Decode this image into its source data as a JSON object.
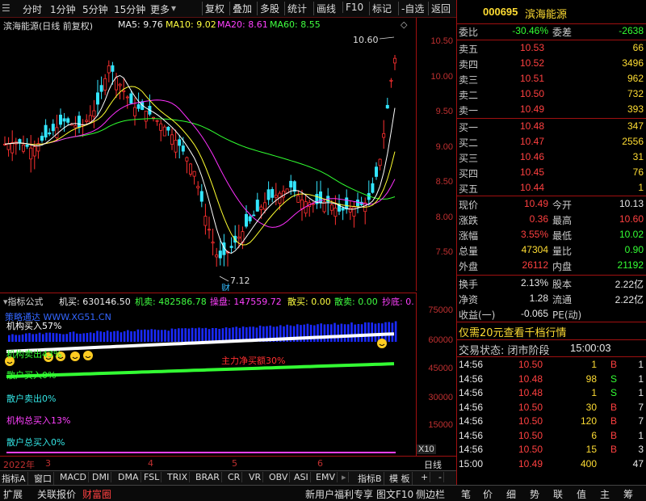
{
  "toolbar": {
    "periods": [
      "分时",
      "1分钟",
      "5分钟",
      "15分钟",
      "更多"
    ],
    "buttons": [
      "复权",
      "叠加",
      "多股",
      "统计",
      "画线",
      "F10",
      "标记",
      "-自选",
      "返回"
    ]
  },
  "chart_header": {
    "name": "滨海能源(日线 前复权)",
    "ma5": "MA5: 9.76",
    "ma10": "MA10: 9.02",
    "ma20": "MA20: 8.61",
    "ma60": "MA60: 8.55",
    "high_mark": "10.60",
    "low_mark": "7.12",
    "cai_mark": "财"
  },
  "colors": {
    "up": "#ff3030",
    "down": "#33e6ff",
    "ma5": "#ffffff",
    "ma10": "#ffff30",
    "ma20": "#ff30ff",
    "ma60": "#30ff30",
    "border": "#a01010"
  },
  "price_axis": [
    "10.50",
    "10.00",
    "9.50",
    "9.00",
    "8.50",
    "8.00",
    "7.50"
  ],
  "indicator": {
    "title": "指标公式",
    "jimai": "机买: 630146.50",
    "jimai2": "机卖: 482586.78",
    "caopan": "操盘: 147559.72",
    "sanmai": "散买: 0.00",
    "sanmai2": "散卖: 0.00",
    "chaodi": "抄底: 0.",
    "watermark": "策略通达 WWW.XG51.CN",
    "labels": {
      "jigou_buy": "机构买入57%",
      "jigou_sell": "机构卖出43%",
      "sanhu_buy": "散户买入0%",
      "zhuli": "主力净买额30%",
      "sanhu_sell": "散户卖出0%",
      "jigou_total": "机构总买入13%",
      "sanhu_total": "散户总买入0%"
    },
    "axis": [
      "75000",
      "60000",
      "45000",
      "30000",
      "15000"
    ],
    "x10": "X10"
  },
  "dates": {
    "year": "2022年",
    "m3": "3",
    "m4": "4",
    "m5": "5",
    "m6": "6",
    "period": "日线"
  },
  "tabs": [
    "指标A",
    "窗口",
    "MACD",
    "DMI",
    "DMA",
    "FSL",
    "TRIX",
    "BRAR",
    "CR",
    "VR",
    "OBV",
    "ASI",
    "EMV",
    "指标B",
    "模 板",
    "+",
    "-"
  ],
  "bottom": {
    "left": [
      "扩展",
      "关联报价",
      "财富圈"
    ],
    "ad": "新用户福利专享",
    "right": [
      "图文F10",
      "侧边栏",
      "笔",
      "价",
      "细",
      "势",
      "联",
      "值",
      "主",
      "筹"
    ]
  },
  "quote": {
    "code": "000695",
    "name": "滨海能源",
    "weibi_label": "委比",
    "weibi": "-30.46%",
    "weicha_label": "委差",
    "weicha": "-2638",
    "asks": [
      {
        "label": "卖五",
        "price": "10.53",
        "vol": "66"
      },
      {
        "label": "卖四",
        "price": "10.52",
        "vol": "3496"
      },
      {
        "label": "卖三",
        "price": "10.51",
        "vol": "962"
      },
      {
        "label": "卖二",
        "price": "10.50",
        "vol": "732"
      },
      {
        "label": "卖一",
        "price": "10.49",
        "vol": "393"
      }
    ],
    "bids": [
      {
        "label": "买一",
        "price": "10.48",
        "vol": "347"
      },
      {
        "label": "买二",
        "price": "10.47",
        "vol": "2556"
      },
      {
        "label": "买三",
        "price": "10.46",
        "vol": "31"
      },
      {
        "label": "买四",
        "price": "10.45",
        "vol": "76"
      },
      {
        "label": "买五",
        "price": "10.44",
        "vol": "1"
      }
    ],
    "stats": [
      {
        "l1": "现价",
        "v1": "10.49",
        "c1": "red",
        "l2": "今开",
        "v2": "10.13",
        "c2": "white"
      },
      {
        "l1": "涨跌",
        "v1": "0.36",
        "c1": "red",
        "l2": "最高",
        "v2": "10.60",
        "c2": "red"
      },
      {
        "l1": "涨幅",
        "v1": "3.55%",
        "c1": "red",
        "l2": "最低",
        "v2": "10.02",
        "c2": "green"
      },
      {
        "l1": "总量",
        "v1": "47304",
        "c1": "yellow",
        "l2": "量比",
        "v2": "0.90",
        "c2": "green"
      },
      {
        "l1": "外盘",
        "v1": "26112",
        "c1": "red",
        "l2": "内盘",
        "v2": "21192",
        "c2": "green"
      }
    ],
    "stats2": [
      {
        "l1": "换手",
        "v1": "2.13%",
        "l2": "股本",
        "v2": "2.22亿"
      },
      {
        "l1": "净资",
        "v1": "1.28",
        "l2": "流通",
        "v2": "2.22亿"
      },
      {
        "l1": "收益(一)",
        "v1": "-0.065",
        "l2": "PE(动)",
        "v2": ""
      }
    ],
    "promo": "仅需20元查看千档行情",
    "status_label": "交易状态: 闭市阶段",
    "status_time": "15:00:03",
    "ticks": [
      {
        "t": "14:56",
        "p": "10.50",
        "v": "1",
        "d": "B",
        "n": "1",
        "dc": "red"
      },
      {
        "t": "14:56",
        "p": "10.48",
        "v": "98",
        "d": "S",
        "n": "1",
        "dc": "green"
      },
      {
        "t": "14:56",
        "p": "10.48",
        "v": "1",
        "d": "S",
        "n": "1",
        "dc": "green"
      },
      {
        "t": "14:56",
        "p": "10.50",
        "v": "30",
        "d": "B",
        "n": "7",
        "dc": "red"
      },
      {
        "t": "14:56",
        "p": "10.50",
        "v": "120",
        "d": "B",
        "n": "7",
        "dc": "red"
      },
      {
        "t": "14:56",
        "p": "10.50",
        "v": "6",
        "d": "B",
        "n": "1",
        "dc": "red"
      },
      {
        "t": "14:56",
        "p": "10.50",
        "v": "15",
        "d": "B",
        "n": "3",
        "dc": "red"
      },
      {
        "t": "15:00",
        "p": "10.49",
        "v": "400",
        "d": "",
        "n": "47",
        "dc": "white"
      }
    ]
  }
}
